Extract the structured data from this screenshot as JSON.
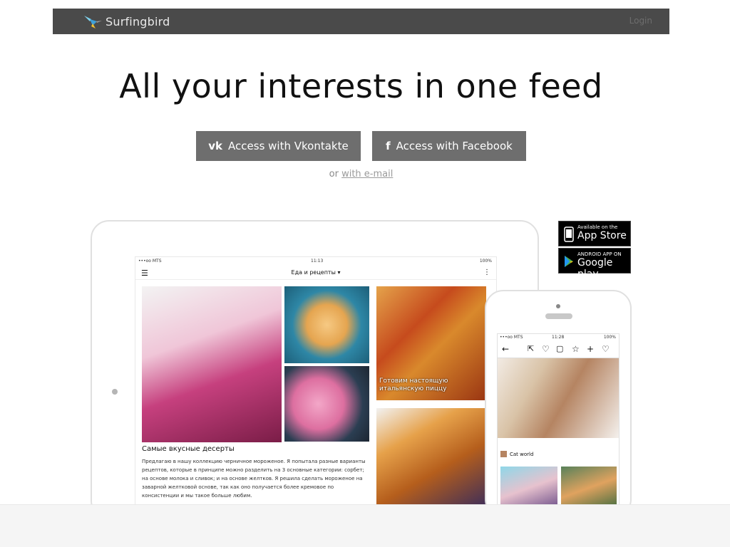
{
  "brand": {
    "name": "Surfingbird"
  },
  "nav": {
    "login_label": "Login"
  },
  "hero": {
    "headline": "All your interests in one feed",
    "vk_button": "Access with Vkontakte",
    "fb_button": "Access with Facebook",
    "or_text": "or",
    "email_link": "with e-mail"
  },
  "badges": {
    "apple_small": "Available on the",
    "apple_big": "App Store",
    "google_small": "ANDROID APP ON",
    "google_big": "Google play"
  },
  "tablet": {
    "status_left": "•••oo MTS",
    "status_time": "11:13",
    "status_right": "100%",
    "title": "Еда и рецепты ▾",
    "tile_caption": "Готовим настоящую итальянскую пиццу",
    "article_title": "Самые вкусные десерты",
    "article_body": "Предлагаю в нашу коллекцию черничное мороженое. Я попытала разные варианты рецептов, которые в принципе можно разделить на 3 основные категории: сорбет; на основе молока и сливок; и на основе желтков. Я решила сделать мороженое на заварной желтковой основе, так как оно получается более кремовое по консистенции и мы такое больше любим."
  },
  "phone": {
    "status_left": "•••oo MTS",
    "status_time": "11:28",
    "status_right": "100%",
    "caption": "Cat world"
  },
  "colors": {
    "topbar": "#4a4a4a",
    "button": "#6e6e6e"
  }
}
